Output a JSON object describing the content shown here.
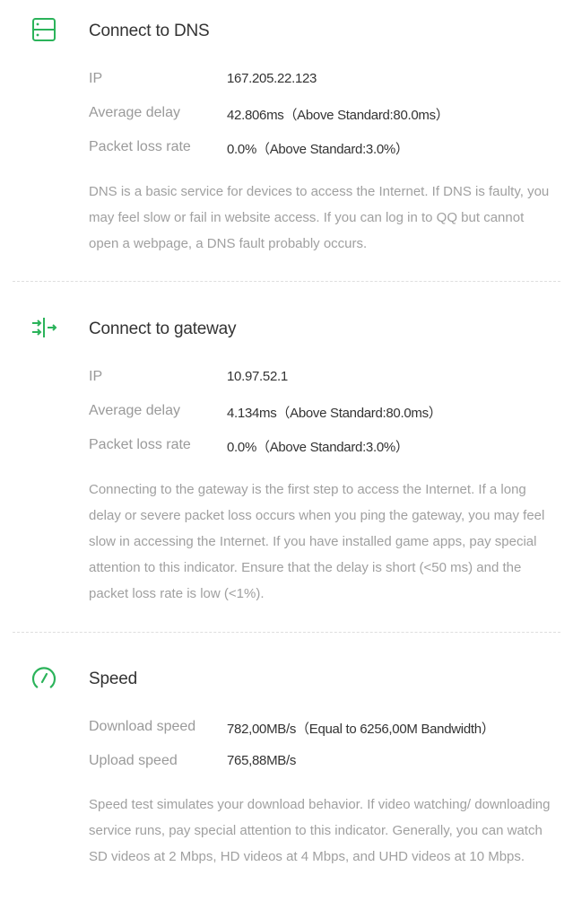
{
  "colors": {
    "accent": "#2bb35a",
    "title": "#333333",
    "label": "#9a9a9a",
    "description": "#a0a0a0"
  },
  "dns": {
    "icon": "server-icon",
    "title": "Connect to DNS",
    "rows": [
      {
        "label": "IP",
        "value": "167.205.22.123"
      },
      {
        "label": "Average delay",
        "value": "42.806ms（Above Standard:80.0ms）"
      },
      {
        "label": "Packet loss rate",
        "value": "0.0%（Above Standard:3.0%）"
      }
    ],
    "description": "DNS is a basic service for devices to access the Internet. If DNS is faulty, you may feel slow or fail in website access. If you can log in to QQ but cannot open a webpage, a DNS fault probably occurs."
  },
  "gateway": {
    "icon": "gateway-arrows-icon",
    "title": "Connect to gateway",
    "rows": [
      {
        "label": "IP",
        "value": "10.97.52.1"
      },
      {
        "label": "Average delay",
        "value": "4.134ms（Above Standard:80.0ms）"
      },
      {
        "label": "Packet loss rate",
        "value": "0.0%（Above Standard:3.0%）"
      }
    ],
    "description": "Connecting to the gateway is the first step to access the Internet. If a long delay or severe packet loss occurs when you ping the gateway, you may feel slow in accessing the Internet. If you have installed game apps, pay special attention to this indicator. Ensure that the delay is short (<50 ms) and the packet loss rate is low (<1%)."
  },
  "speed": {
    "icon": "speedometer-icon",
    "title": "Speed",
    "rows": [
      {
        "label": "Download speed",
        "value": "782,00MB/s（Equal to 6256,00M Bandwidth）"
      },
      {
        "label": "Upload speed",
        "value": "765,88MB/s"
      }
    ],
    "description": "Speed test simulates your download behavior. If video watching/ downloading service runs, pay special attention to this indicator. Generally, you can watch SD videos at 2 Mbps, HD videos at 4 Mbps, and UHD videos at 10 Mbps."
  }
}
